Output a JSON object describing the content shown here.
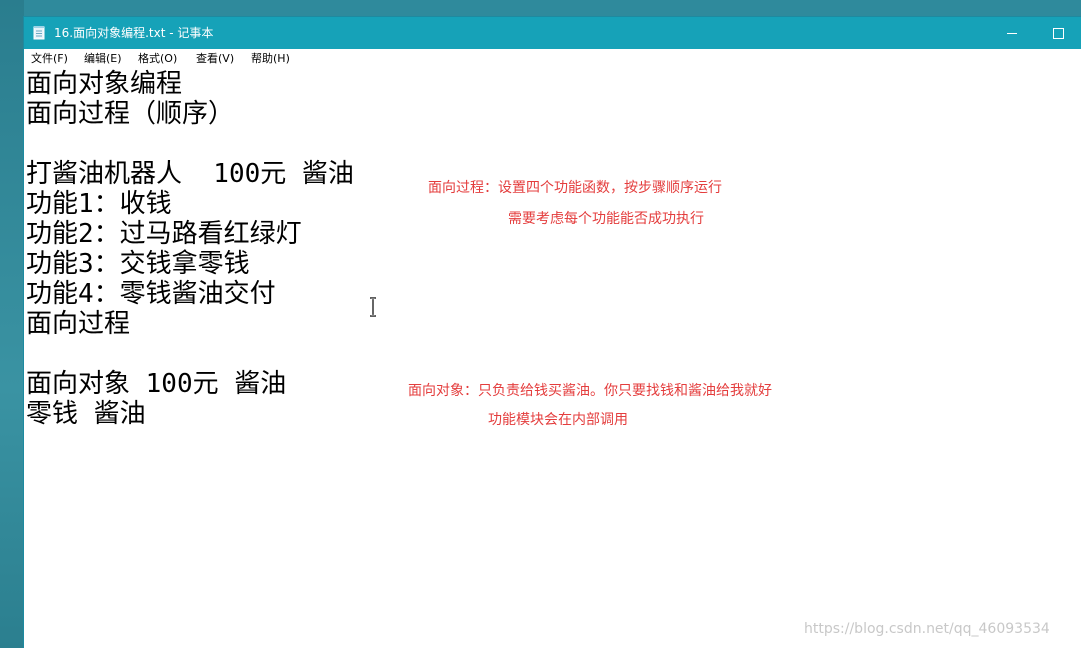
{
  "window": {
    "title": "16.面向对象编程.txt - 记事本",
    "app_icon": "notepad-icon",
    "controls": {
      "minimize_icon": "minimize-icon",
      "maximize_icon": "maximize-icon"
    },
    "titlebar_color": "#16a2b8"
  },
  "menu": {
    "items": [
      "文件(F)",
      "编辑(E)",
      "格式(O)",
      "查看(V)",
      "帮助(H)"
    ]
  },
  "document": {
    "lines": [
      "面向对象编程",
      "面向过程（顺序）",
      "",
      "打酱油机器人  100元 酱油",
      "功能1：收钱",
      "功能2：过马路看红绿灯",
      "功能3：交钱拿零钱",
      "功能4：零钱酱油交付",
      "面向过程",
      "",
      "面向对象 100元 酱油",
      "零钱 酱油"
    ]
  },
  "annotations": {
    "procedural_line1": "面向过程：设置四个功能函数，按步骤顺序运行",
    "procedural_line2": "需要考虑每个功能能否成功执行",
    "oop_line1": "面向对象：只负责给钱买酱油。你只要找钱和酱油给我就好",
    "oop_line2": "功能模块会在内部调用",
    "color": "#e43d3d"
  },
  "cursor_icon": "text-cursor-icon",
  "watermark": "https://blog.csdn.net/qq_46093534"
}
